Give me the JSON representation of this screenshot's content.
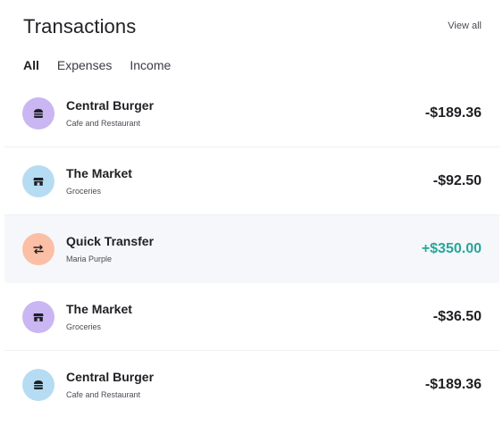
{
  "header": {
    "title": "Transactions",
    "view_all": "View all"
  },
  "tabs": [
    {
      "label": "All",
      "active": true
    },
    {
      "label": "Expenses",
      "active": false
    },
    {
      "label": "Income",
      "active": false
    }
  ],
  "transactions": [
    {
      "name": "Central Burger",
      "category": "Cafe and Restaurant",
      "amount": "-$189.36",
      "icon": "burger-icon",
      "avatar_color": "#c9b6f2",
      "type": "expense"
    },
    {
      "name": "The Market",
      "category": "Groceries",
      "amount": "-$92.50",
      "icon": "store-icon",
      "avatar_color": "#b6dcf3",
      "type": "expense"
    },
    {
      "name": "Quick Transfer",
      "category": "Maria Purple",
      "amount": "+$350.00",
      "icon": "transfer-icon",
      "avatar_color": "#fbbfa6",
      "type": "income"
    },
    {
      "name": "The Market",
      "category": "Groceries",
      "amount": "-$36.50",
      "icon": "store-icon",
      "avatar_color": "#c9b6f2",
      "type": "expense"
    },
    {
      "name": "Central Burger",
      "category": "Cafe and Restaurant",
      "amount": "-$189.36",
      "icon": "burger-icon",
      "avatar_color": "#b6dcf3",
      "type": "expense"
    }
  ],
  "colors": {
    "income": "#26a69a",
    "expense": "#1f2024"
  }
}
